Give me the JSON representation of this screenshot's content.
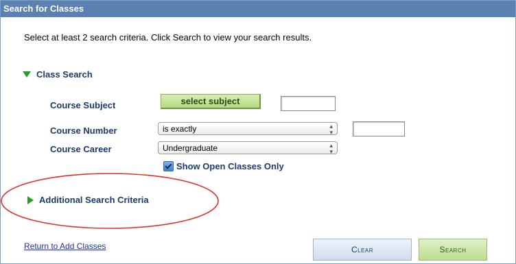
{
  "panel": {
    "title": "Search for Classes"
  },
  "instructions": "Select at least 2 search criteria. Click Search to view your search results.",
  "class_search": {
    "heading": "Class Search",
    "course_subject": {
      "label": "Course Subject",
      "button": "select subject",
      "value": ""
    },
    "course_number": {
      "label": "Course Number",
      "operator": "is exactly",
      "value": ""
    },
    "course_career": {
      "label": "Course Career",
      "value": "Undergraduate"
    },
    "open_classes": {
      "label": "Show Open Classes Only",
      "checked": true
    }
  },
  "additional": {
    "label": "Additional Search Criteria"
  },
  "footer": {
    "return_link": "Return to Add Classes",
    "clear": "Clear",
    "search": "Search"
  },
  "colors": {
    "title_bar": "#5b80b2",
    "label_blue": "#1c3a6b",
    "accent_green": "#2a9a2a",
    "annotation_red": "#e0302a"
  }
}
